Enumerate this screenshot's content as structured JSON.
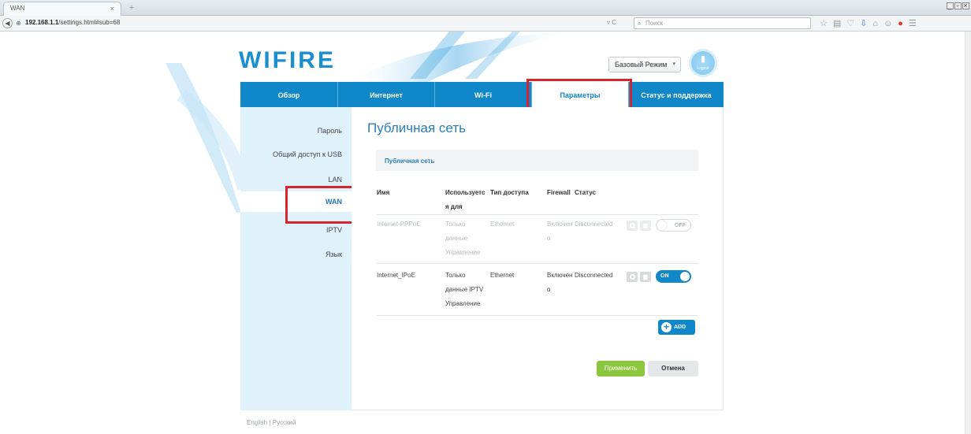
{
  "browser": {
    "tab_title": "WAN",
    "tab_close": "×",
    "new_tab": "+",
    "back": "◀",
    "url_host": "192.168.1.1",
    "url_path": "/settings.html#sub=68",
    "url_controls": "▿ C",
    "search_placeholder": "Поиск",
    "window_controls": [
      "_",
      "▫",
      "×"
    ]
  },
  "header": {
    "logo_text": "WIFIRE",
    "mode_select_value": "Базовый Режим",
    "logout_label": "Logout"
  },
  "nav": {
    "tabs": [
      {
        "label": "Обзор"
      },
      {
        "label": "Интернет"
      },
      {
        "label": "Wi-Fi"
      },
      {
        "label": "Параметры"
      },
      {
        "label": "Статус и поддержка"
      }
    ],
    "active_tab": "Параметры"
  },
  "sidebar": {
    "items": [
      {
        "label": "Пароль"
      },
      {
        "label": "Общий доступ к USB"
      },
      {
        "label": "LAN"
      },
      {
        "label": "WAN"
      },
      {
        "label": "IPTV"
      },
      {
        "label": "Язык"
      }
    ],
    "active_item": "WAN"
  },
  "main": {
    "title": "Публичная сеть",
    "section_label": "Публичная сеть",
    "table": {
      "headers": {
        "name": "Имя",
        "used_for_1": "Используетс",
        "used_for_2": "я для",
        "access_type": "Тип доступа",
        "firewall": "Firewall",
        "status": "Статус"
      },
      "rows": [
        {
          "name": "Internet-PPPoE",
          "used_for_1": "Только",
          "used_for_2": "данные",
          "used_for_3": "Управление",
          "access_type": "Ethernet",
          "firewall": "Включен",
          "status_1": "Disconnected",
          "status_2": "о",
          "toggle": "OFF"
        },
        {
          "name": "Internet_IPoE",
          "used_for_1": "Только",
          "used_for_2": "данные IPTV",
          "used_for_3": "Управление",
          "access_type": "Ethernet",
          "firewall": "Включен",
          "status_1": "Disconnected",
          "status_2": "о",
          "toggle": "ON"
        }
      ]
    },
    "add_button": "ADD",
    "apply_button": "Применить",
    "cancel_button": "Отмена"
  },
  "footer": {
    "languages": "English | Русский"
  },
  "colors": {
    "brand_blue": "#0f87c8",
    "logo_orange": "#f0a21e",
    "apply_green": "#8cc63f",
    "highlight_red": "#d8242f",
    "sidebar_bg": "#dff1fb"
  }
}
